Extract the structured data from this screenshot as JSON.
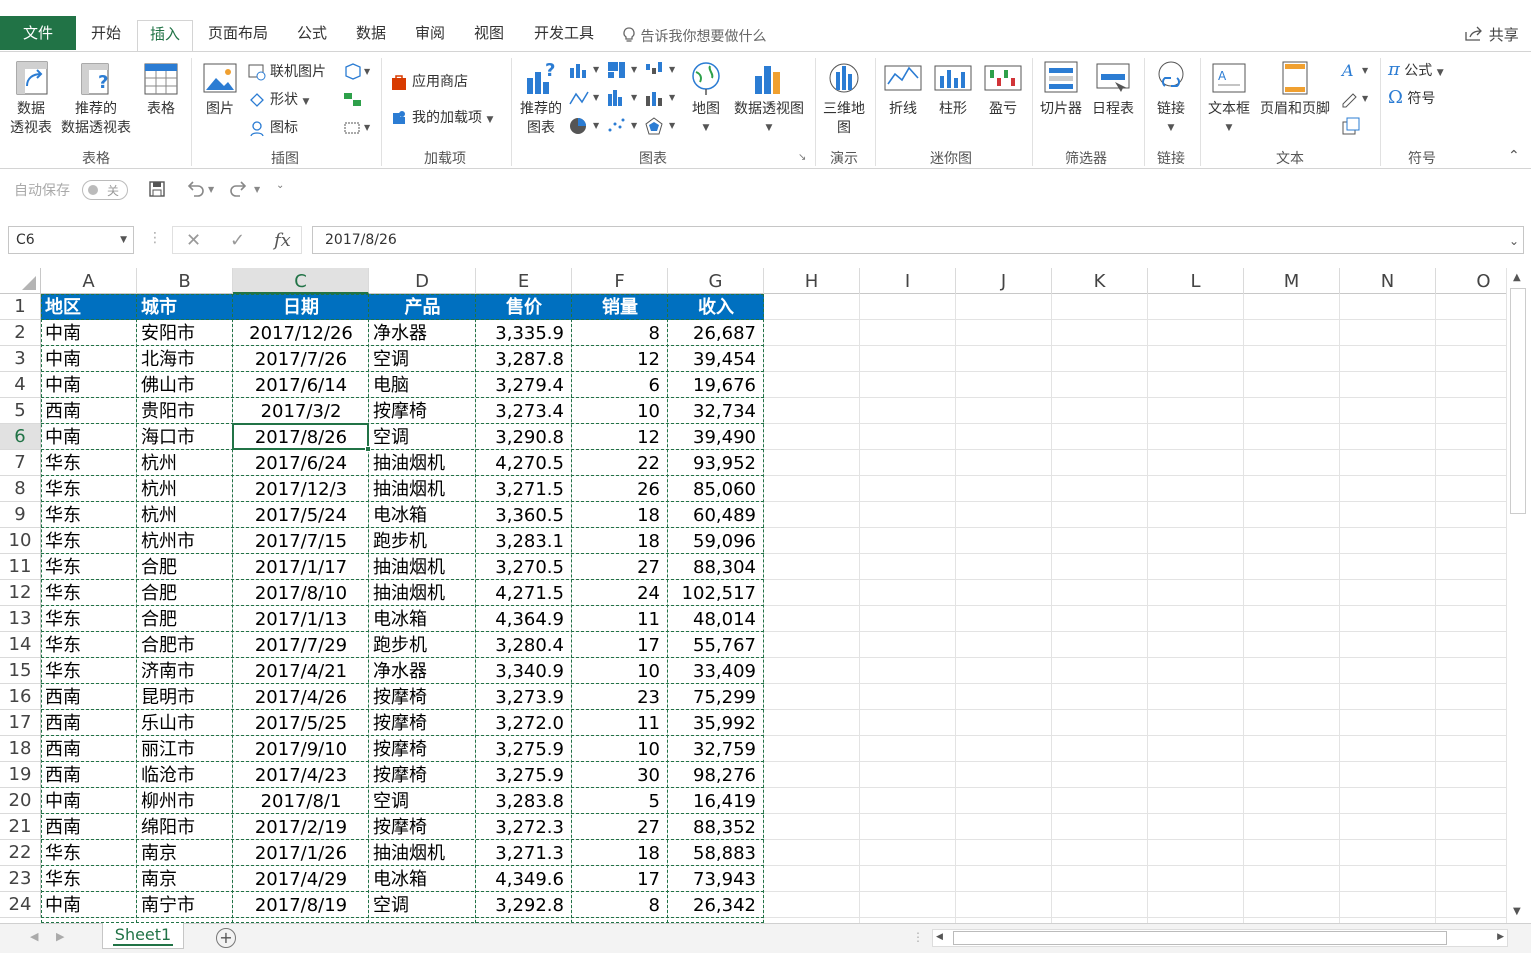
{
  "ribbon_tabs": [
    {
      "label": "文件"
    },
    {
      "label": "开始"
    },
    {
      "label": "插入"
    },
    {
      "label": "页面布局"
    },
    {
      "label": "公式"
    },
    {
      "label": "数据"
    },
    {
      "label": "审阅"
    },
    {
      "label": "视图"
    },
    {
      "label": "开发工具"
    }
  ],
  "active_tab": "插入",
  "tell_me": "告诉我你想要做什么",
  "share": "共享",
  "ribbon": {
    "tables": {
      "label": "表格",
      "pivot": "数据\n透视表",
      "pivot_line1": "数据",
      "pivot_line2": "透视表",
      "rec_pivot_line1": "推荐的",
      "rec_pivot_line2": "数据透视表",
      "table": "表格"
    },
    "illustrations": {
      "label": "插图",
      "picture": "图片",
      "online_picture": "联机图片",
      "shapes": "形状",
      "icons": "图标"
    },
    "addins": {
      "label": "加载项",
      "store": "应用商店",
      "my_addins": "我的加载项"
    },
    "charts": {
      "label": "图表",
      "rec_charts_line1": "推荐的",
      "rec_charts_line2": "图表",
      "map": "地图",
      "pivot_chart": "数据透视图"
    },
    "tours": {
      "label": "演示",
      "map3d_line1": "三维地",
      "map3d_line2": "图"
    },
    "sparklines": {
      "label": "迷你图",
      "line": "折线",
      "column": "柱形",
      "winloss": "盈亏"
    },
    "filters": {
      "label": "筛选器",
      "slicer": "切片器",
      "timeline": "日程表"
    },
    "links": {
      "label": "链接",
      "link": "链接"
    },
    "text": {
      "label": "文本",
      "textbox": "文本框",
      "header_footer": "页眉和页脚"
    },
    "symbols": {
      "label": "符号",
      "equation": "公式",
      "symbol": "符号"
    }
  },
  "qat": {
    "autosave": "自动保存",
    "toggle": "关"
  },
  "formula_bar": {
    "name_box": "C6",
    "formula": "2017/8/26"
  },
  "columns": [
    "A",
    "B",
    "C",
    "D",
    "E",
    "F",
    "G",
    "H",
    "I",
    "J",
    "K",
    "L",
    "M",
    "N",
    "O"
  ],
  "selected_column": "C",
  "selected_row": "6",
  "table_header": [
    "地区",
    "城市",
    "日期",
    "产品",
    "售价",
    "销量",
    "收入"
  ],
  "rows": [
    [
      "中南",
      "安阳市",
      "2017/12/26",
      "净水器",
      "3,335.9",
      "8",
      "26,687"
    ],
    [
      "中南",
      "北海市",
      "2017/7/26",
      "空调",
      "3,287.8",
      "12",
      "39,454"
    ],
    [
      "中南",
      "佛山市",
      "2017/6/14",
      "电脑",
      "3,279.4",
      "6",
      "19,676"
    ],
    [
      "西南",
      "贵阳市",
      "2017/3/2",
      "按摩椅",
      "3,273.4",
      "10",
      "32,734"
    ],
    [
      "中南",
      "海口市",
      "2017/8/26",
      "空调",
      "3,290.8",
      "12",
      "39,490"
    ],
    [
      "华东",
      "杭州",
      "2017/6/24",
      "抽油烟机",
      "4,270.5",
      "22",
      "93,952"
    ],
    [
      "华东",
      "杭州",
      "2017/12/3",
      "抽油烟机",
      "3,271.5",
      "26",
      "85,060"
    ],
    [
      "华东",
      "杭州",
      "2017/5/24",
      "电冰箱",
      "3,360.5",
      "18",
      "60,489"
    ],
    [
      "华东",
      "杭州市",
      "2017/7/15",
      "跑步机",
      "3,283.1",
      "18",
      "59,096"
    ],
    [
      "华东",
      "合肥",
      "2017/1/17",
      "抽油烟机",
      "3,270.5",
      "27",
      "88,304"
    ],
    [
      "华东",
      "合肥",
      "2017/8/10",
      "抽油烟机",
      "4,271.5",
      "24",
      "102,517"
    ],
    [
      "华东",
      "合肥",
      "2017/1/13",
      "电冰箱",
      "4,364.9",
      "11",
      "48,014"
    ],
    [
      "华东",
      "合肥市",
      "2017/7/29",
      "跑步机",
      "3,280.4",
      "17",
      "55,767"
    ],
    [
      "华东",
      "济南市",
      "2017/4/21",
      "净水器",
      "3,340.9",
      "10",
      "33,409"
    ],
    [
      "西南",
      "昆明市",
      "2017/4/26",
      "按摩椅",
      "3,273.9",
      "23",
      "75,299"
    ],
    [
      "西南",
      "乐山市",
      "2017/5/25",
      "按摩椅",
      "3,272.0",
      "11",
      "35,992"
    ],
    [
      "西南",
      "丽江市",
      "2017/9/10",
      "按摩椅",
      "3,275.9",
      "10",
      "32,759"
    ],
    [
      "西南",
      "临沧市",
      "2017/4/23",
      "按摩椅",
      "3,275.9",
      "30",
      "98,276"
    ],
    [
      "中南",
      "柳州市",
      "2017/8/1",
      "空调",
      "3,283.8",
      "5",
      "16,419"
    ],
    [
      "西南",
      "绵阳市",
      "2017/2/19",
      "按摩椅",
      "3,272.3",
      "27",
      "88,352"
    ],
    [
      "华东",
      "南京",
      "2017/1/26",
      "抽油烟机",
      "3,271.3",
      "18",
      "58,883"
    ],
    [
      "华东",
      "南京",
      "2017/4/29",
      "电冰箱",
      "4,349.6",
      "17",
      "73,943"
    ],
    [
      "中南",
      "南宁市",
      "2017/8/19",
      "空调",
      "3,292.8",
      "8",
      "26,342"
    ]
  ],
  "sheet_tab": "Sheet1",
  "colors": {
    "excel_green": "#217346",
    "header_fill": "#0070c0"
  }
}
